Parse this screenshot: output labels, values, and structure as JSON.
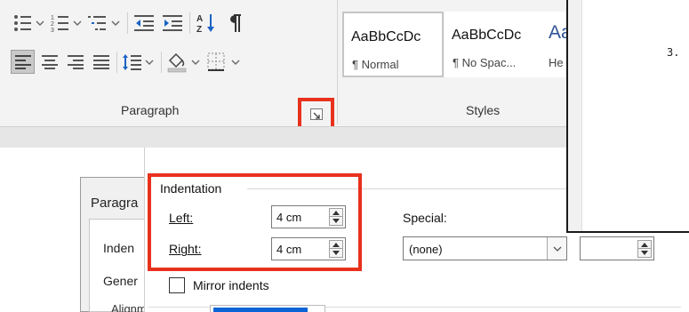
{
  "ribbon": {
    "paragraph_group_label": "Paragraph",
    "styles_group_label": "Styles",
    "style_tiles": [
      {
        "sample": "AaBbCcDc",
        "name": "¶ Normal",
        "active": true
      },
      {
        "sample": "AaBbCcDc",
        "name": "¶ No Spac...",
        "active": false
      },
      {
        "sample": "Aa",
        "name": "He",
        "active": false
      }
    ]
  },
  "document": {
    "list_number": "3."
  },
  "dialog": {
    "title": "Paragra",
    "tabs": [
      "Inden",
      "Gener"
    ],
    "general_alignment_label": "Alignment:",
    "indentation": {
      "section_label": "Indentation",
      "left_label": "Left:",
      "left_value": "4 cm",
      "right_label": "Right:",
      "right_value": "4 cm"
    },
    "special": {
      "label": "Special:",
      "value": "(none)",
      "by_value": ""
    },
    "mirror_indents": {
      "label": "Mirror indents",
      "checked": false
    }
  },
  "colors": {
    "highlight": "#e8311d",
    "accent": "#0a64d6"
  }
}
